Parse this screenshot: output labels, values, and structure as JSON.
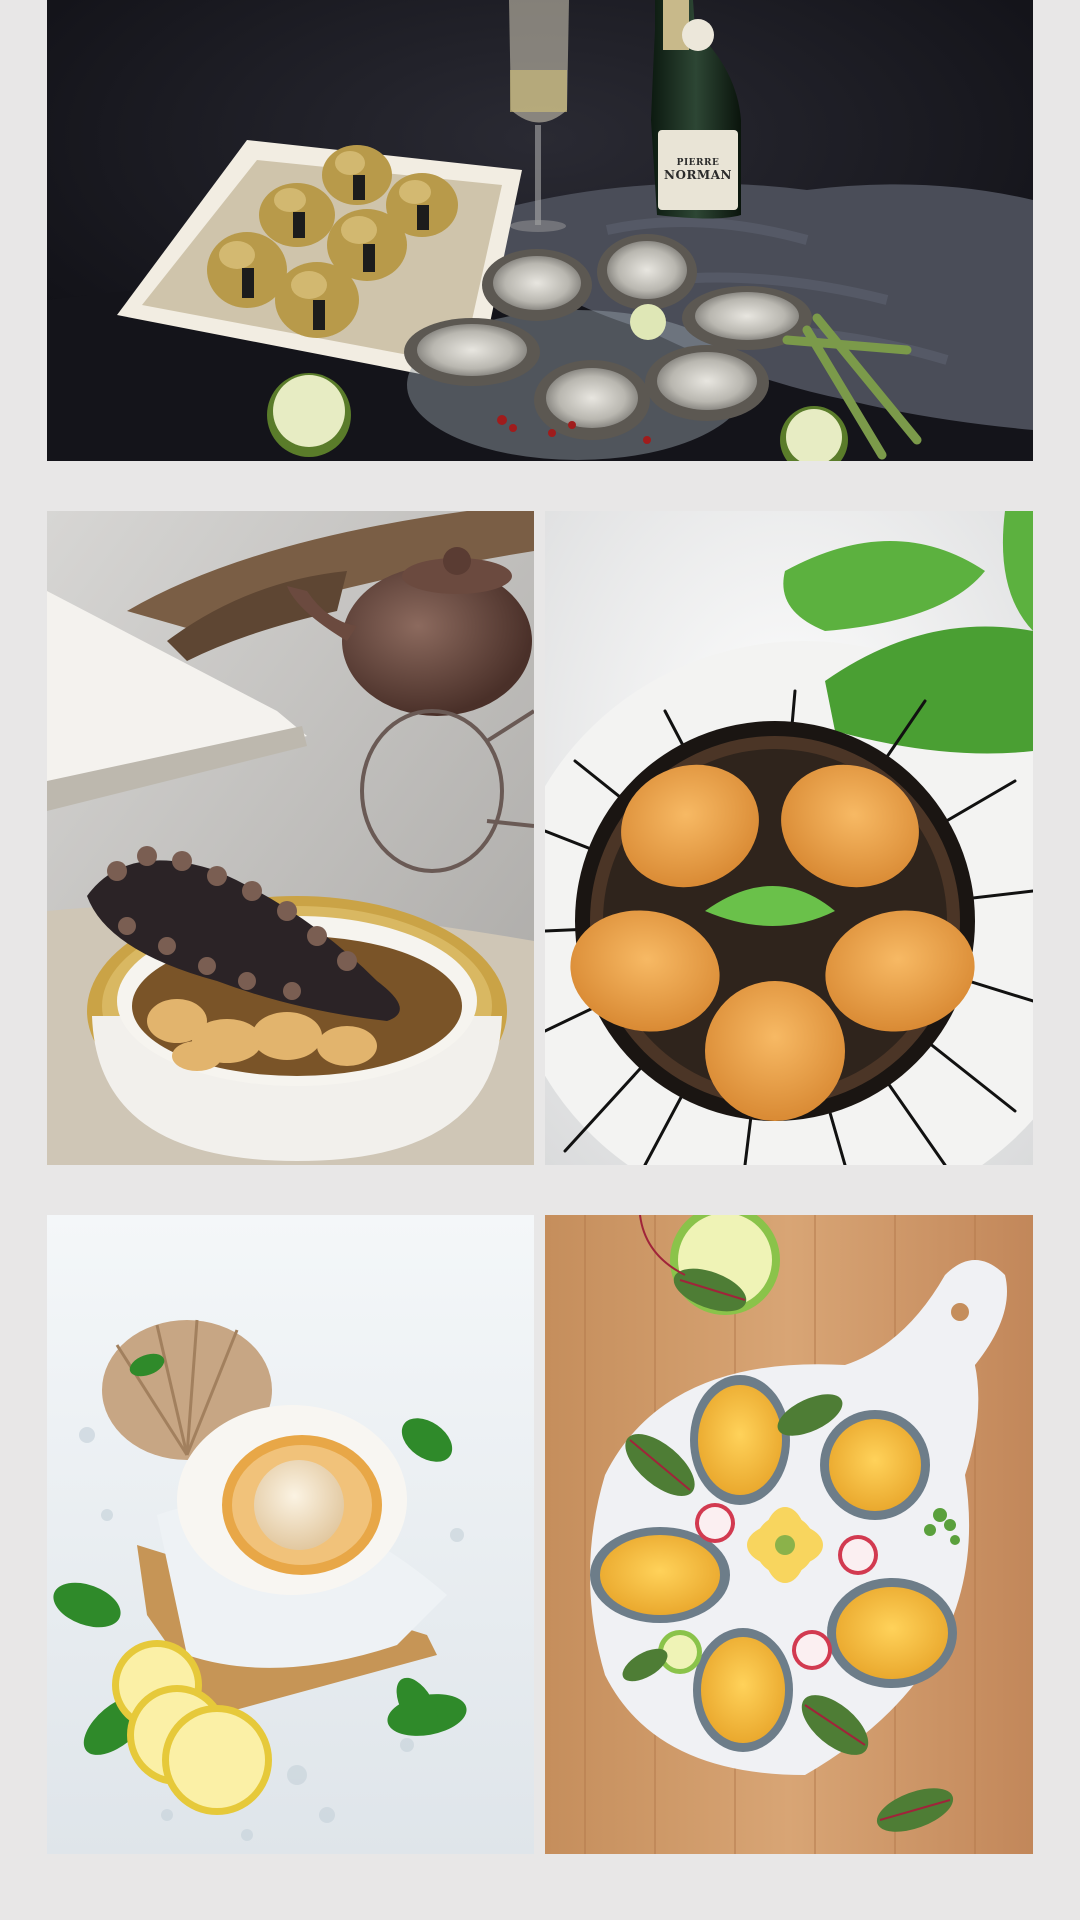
{
  "gallery": {
    "background": "#e8e7e7",
    "photos": [
      {
        "id": "oysters",
        "subject": "oysters-with-champagne"
      },
      {
        "id": "sea-cucumber",
        "subject": "sea-cucumber-in-bowl"
      },
      {
        "id": "sea-urchin",
        "subject": "sea-urchin-on-plate"
      },
      {
        "id": "scallop",
        "subject": "scallop-on-ice-with-lemon"
      },
      {
        "id": "abalone",
        "subject": "abalone-on-serving-board"
      }
    ],
    "wine_label": {
      "line1": "PIERRE",
      "line2": "NORMAN"
    }
  }
}
